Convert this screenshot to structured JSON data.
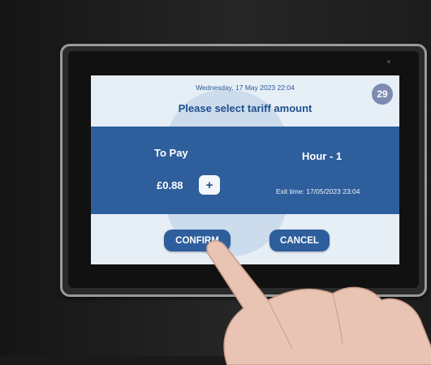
{
  "screen": {
    "datetime": "Wednesday, 17 May 2023 22:04",
    "countdown": "29",
    "title": "Please select tariff amount"
  },
  "tariff": {
    "to_pay_label": "To Pay",
    "amount": "£0.88",
    "increment_label": "+",
    "duration_label": "Hour - 1",
    "exit_time": "Exit time: 17/05/2023 23:04"
  },
  "actions": {
    "confirm_label": "CONFIRM",
    "cancel_label": "CANCEL"
  },
  "colors": {
    "brand_blue": "#2e5e9c",
    "screen_bg": "#e6eef6",
    "timer_badge": "#7d8bb2"
  }
}
